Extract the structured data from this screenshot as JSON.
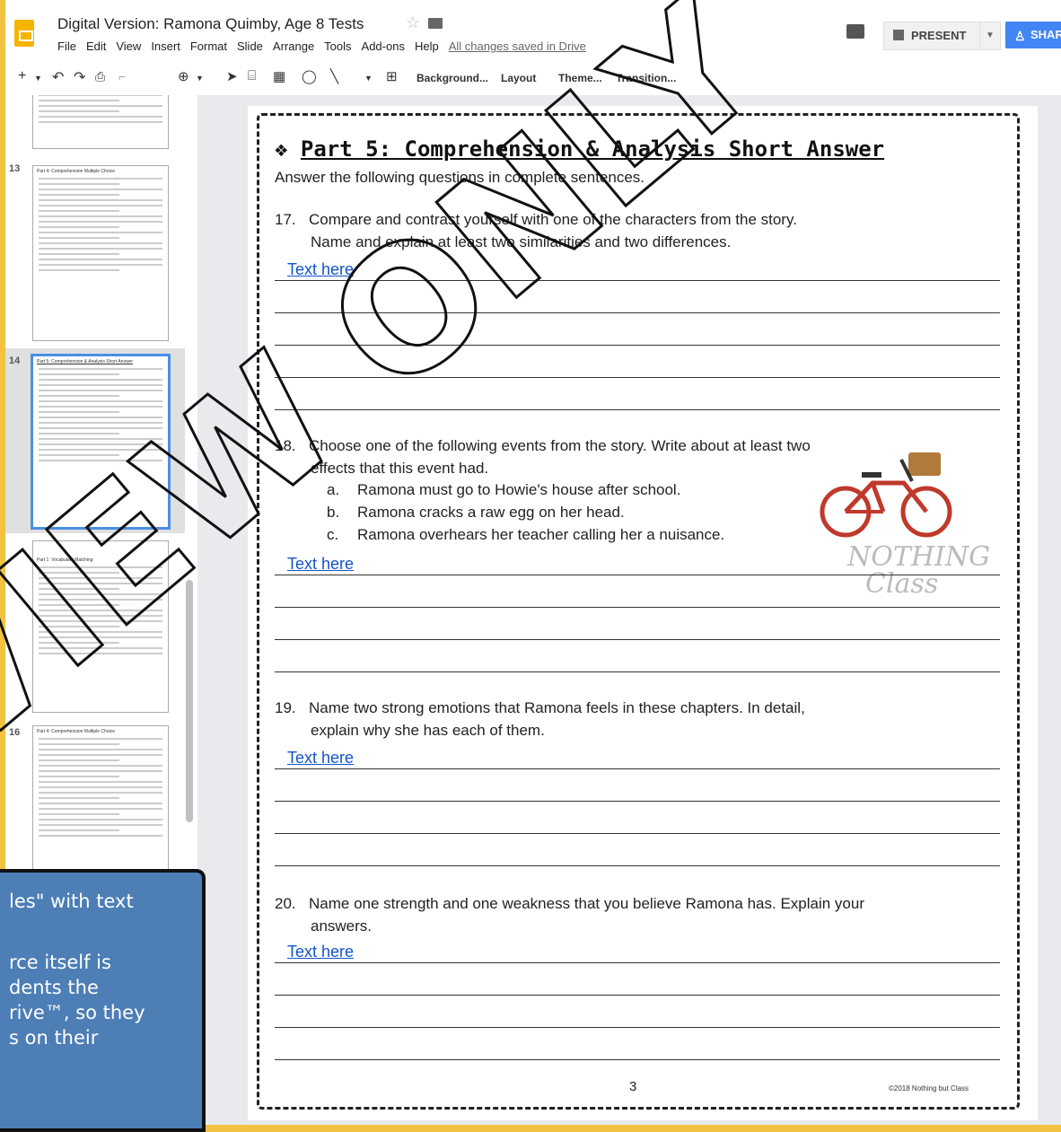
{
  "doc": {
    "title": "Digital Version: Ramona Quimby, Age 8 Tests",
    "menus": [
      "File",
      "Edit",
      "View",
      "Insert",
      "Format",
      "Slide",
      "Arrange",
      "Tools",
      "Add-ons",
      "Help"
    ],
    "saved_status": "All changes saved in Drive",
    "present_label": "PRESENT",
    "share_label": "SHARE"
  },
  "toolbar": {
    "background_label": "Background...",
    "layout_label": "Layout",
    "theme_label": "Theme...",
    "transition_label": "Transition..."
  },
  "filmstrip": {
    "slides": [
      {
        "num": "13",
        "title": "Part 4: Comprehension Multiple Choice"
      },
      {
        "num": "14",
        "title": "Part 5: Comprehension & Analysis Short Answer",
        "selected": true
      },
      {
        "num": "",
        "title": "Part 1: Vocabulary Matching"
      },
      {
        "num": "16",
        "title": "Part 4: Comprehension Multiple Choice"
      }
    ]
  },
  "slide": {
    "heading": "Part 5: Comprehension & Analysis Short Answer",
    "heading_bullet": "❖",
    "instructions": "Answer the following questions in complete sentences.",
    "questions": [
      {
        "num": "17.",
        "line1": "Compare and contrast yourself with one of the characters from the story.",
        "line2": "Name and explain at least two similarities and two differences."
      },
      {
        "num": "18.",
        "line1": "Choose one of the following events from the story. Write about at least two",
        "line2": "effects that this event had.",
        "options": [
          {
            "letter": "a.",
            "text": "Ramona must go to Howie's house after school."
          },
          {
            "letter": "b.",
            "text": "Ramona cracks a raw egg on her head."
          },
          {
            "letter": "c.",
            "text": "Ramona overhears her teacher calling her a nuisance."
          }
        ]
      },
      {
        "num": "19.",
        "line1": "Name two strong emotions that Ramona feels in these chapters. In detail,",
        "line2": "explain why she has each of them."
      },
      {
        "num": "20.",
        "line1": "Name one strength and one weakness that you believe Ramona has. Explain your",
        "line2": "answers."
      }
    ],
    "text_here": "Text here",
    "page_number": "3",
    "copyright": "©2018 Nothing but Class",
    "brand_line1": "NOTHING",
    "brand_line2": "Class"
  },
  "watermark": "VIEW ONLY",
  "callout": {
    "lines": [
      "les\" with text",
      "",
      "rce itself is",
      "dents the",
      "rive™, so they",
      "s on their"
    ]
  },
  "colors": {
    "accent": "#4285f4",
    "app_icon": "#f4b400",
    "page_frame": "#f2c243",
    "callout_bg": "#4d7eb5",
    "link": "#1155cc"
  }
}
